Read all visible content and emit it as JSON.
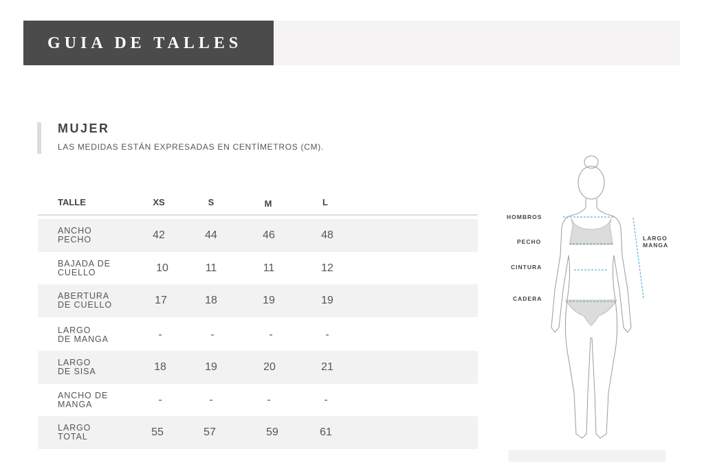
{
  "header": {
    "title": "GUIA DE TALLES"
  },
  "section": {
    "title": "MUJER",
    "subtitle": "LAS MEDIDAS ESTÁN EXPRESADAS EN CENTÍMETROS (CM)."
  },
  "table": {
    "headers": [
      "TALLE",
      "XS",
      "S",
      "M",
      "L"
    ],
    "rows": [
      {
        "label_line1": "ANCHO",
        "label_line2": "PECHO",
        "values": [
          "42",
          "44",
          "46",
          "48"
        ]
      },
      {
        "label_line1": "BAJADA DE",
        "label_line2": "CUELLO",
        "values": [
          "10",
          "11",
          "11",
          "12"
        ]
      },
      {
        "label_line1": "ABERTURA",
        "label_line2": "DE CUELLO",
        "values": [
          "17",
          "18",
          "19",
          "19"
        ]
      },
      {
        "label_line1": "LARGO",
        "label_line2": "DE MANGA",
        "values": [
          "-",
          "-",
          "-",
          "-"
        ]
      },
      {
        "label_line1": "LARGO",
        "label_line2": "DE SISA",
        "values": [
          "18",
          "19",
          "20",
          "21"
        ]
      },
      {
        "label_line1": "ANCHO DE",
        "label_line2": "MANGA",
        "values": [
          "-",
          "-",
          "-",
          "-"
        ]
      },
      {
        "label_line1": "LARGO",
        "label_line2": "TOTAL",
        "values": [
          "55",
          "57",
          "59",
          "61"
        ]
      }
    ]
  },
  "figure": {
    "labels": {
      "hombros": "HOMBROS",
      "pecho": "PECHO",
      "cintura": "CINTURA",
      "cadera": "CADERA",
      "largo_manga_1": "LARGO",
      "largo_manga_2": "MANGA"
    },
    "icon": "female-body-silhouette-icon",
    "measure_line_color": "#3aa3c4"
  },
  "colors": {
    "header_bg": "#4b4b4b",
    "header_band": "#f5f3f3",
    "row_shade": "#f3f2f2",
    "text": "#555555"
  }
}
